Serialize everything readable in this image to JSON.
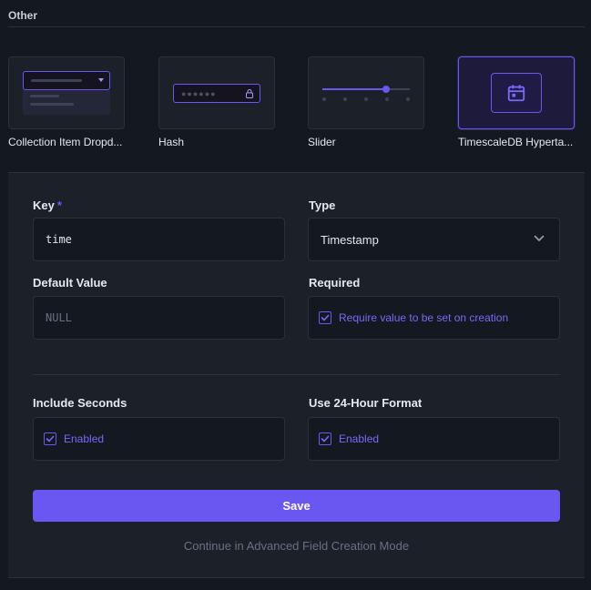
{
  "section": {
    "title": "Other"
  },
  "interfaces": [
    {
      "label": "Collection Item Dropd...",
      "icon": "dropdown-preview-icon",
      "selected": false
    },
    {
      "label": "Hash",
      "icon": "hash-preview-icon",
      "selected": false
    },
    {
      "label": "Slider",
      "icon": "slider-preview-icon",
      "selected": false
    },
    {
      "label": "TimescaleDB Hyperta...",
      "icon": "calendar-icon",
      "selected": true
    }
  ],
  "form": {
    "key": {
      "label": "Key",
      "required_mark": "*",
      "value": "time"
    },
    "type": {
      "label": "Type",
      "value": "Timestamp",
      "icon": "chevron-down-icon"
    },
    "default_value": {
      "label": "Default Value",
      "placeholder": "NULL"
    },
    "required": {
      "label": "Required",
      "checkbox_text": "Require value to be set on creation",
      "checked": true
    },
    "include_seconds": {
      "label": "Include Seconds",
      "checkbox_text": "Enabled",
      "checked": true
    },
    "use_24_hour": {
      "label": "Use 24-Hour Format",
      "checkbox_text": "Enabled",
      "checked": true
    },
    "save_label": "Save",
    "advanced_link": "Continue in Advanced Field Creation Mode"
  },
  "colors": {
    "background": "#141821",
    "panel": "#1c2029",
    "accent": "#6a56f0",
    "border": "#2b303b",
    "muted_text": "#6b7080"
  }
}
